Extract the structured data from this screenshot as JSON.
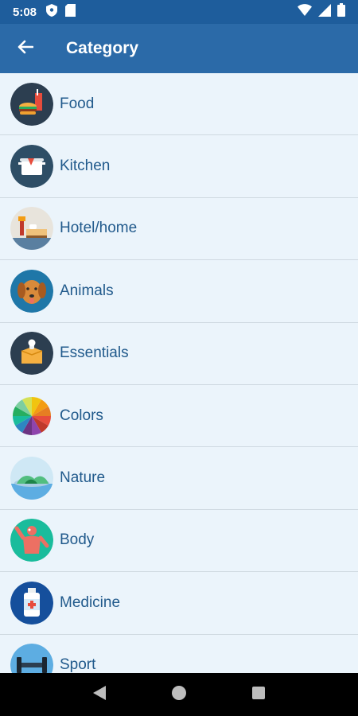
{
  "status_bar": {
    "time": "5:08"
  },
  "app_bar": {
    "title": "Category"
  },
  "categories": [
    {
      "label": "Food",
      "icon": "food-icon"
    },
    {
      "label": "Kitchen",
      "icon": "kitchen-pot-icon"
    },
    {
      "label": "Hotel/home",
      "icon": "hotel-bed-icon"
    },
    {
      "label": "Animals",
      "icon": "dog-icon"
    },
    {
      "label": "Essentials",
      "icon": "essentials-box-icon"
    },
    {
      "label": "Colors",
      "icon": "color-wheel-icon"
    },
    {
      "label": "Nature",
      "icon": "nature-island-icon"
    },
    {
      "label": "Body",
      "icon": "body-icon"
    },
    {
      "label": "Medicine",
      "icon": "medicine-bottle-icon"
    },
    {
      "label": "Sport",
      "icon": "sport-dumbbell-icon"
    }
  ],
  "colors": {
    "status_bar": "#1e5d9c",
    "app_bar": "#2b6aa8",
    "list_background": "#ebf4fb",
    "label_text": "#215a8c",
    "divider": "#cfd9e1"
  }
}
